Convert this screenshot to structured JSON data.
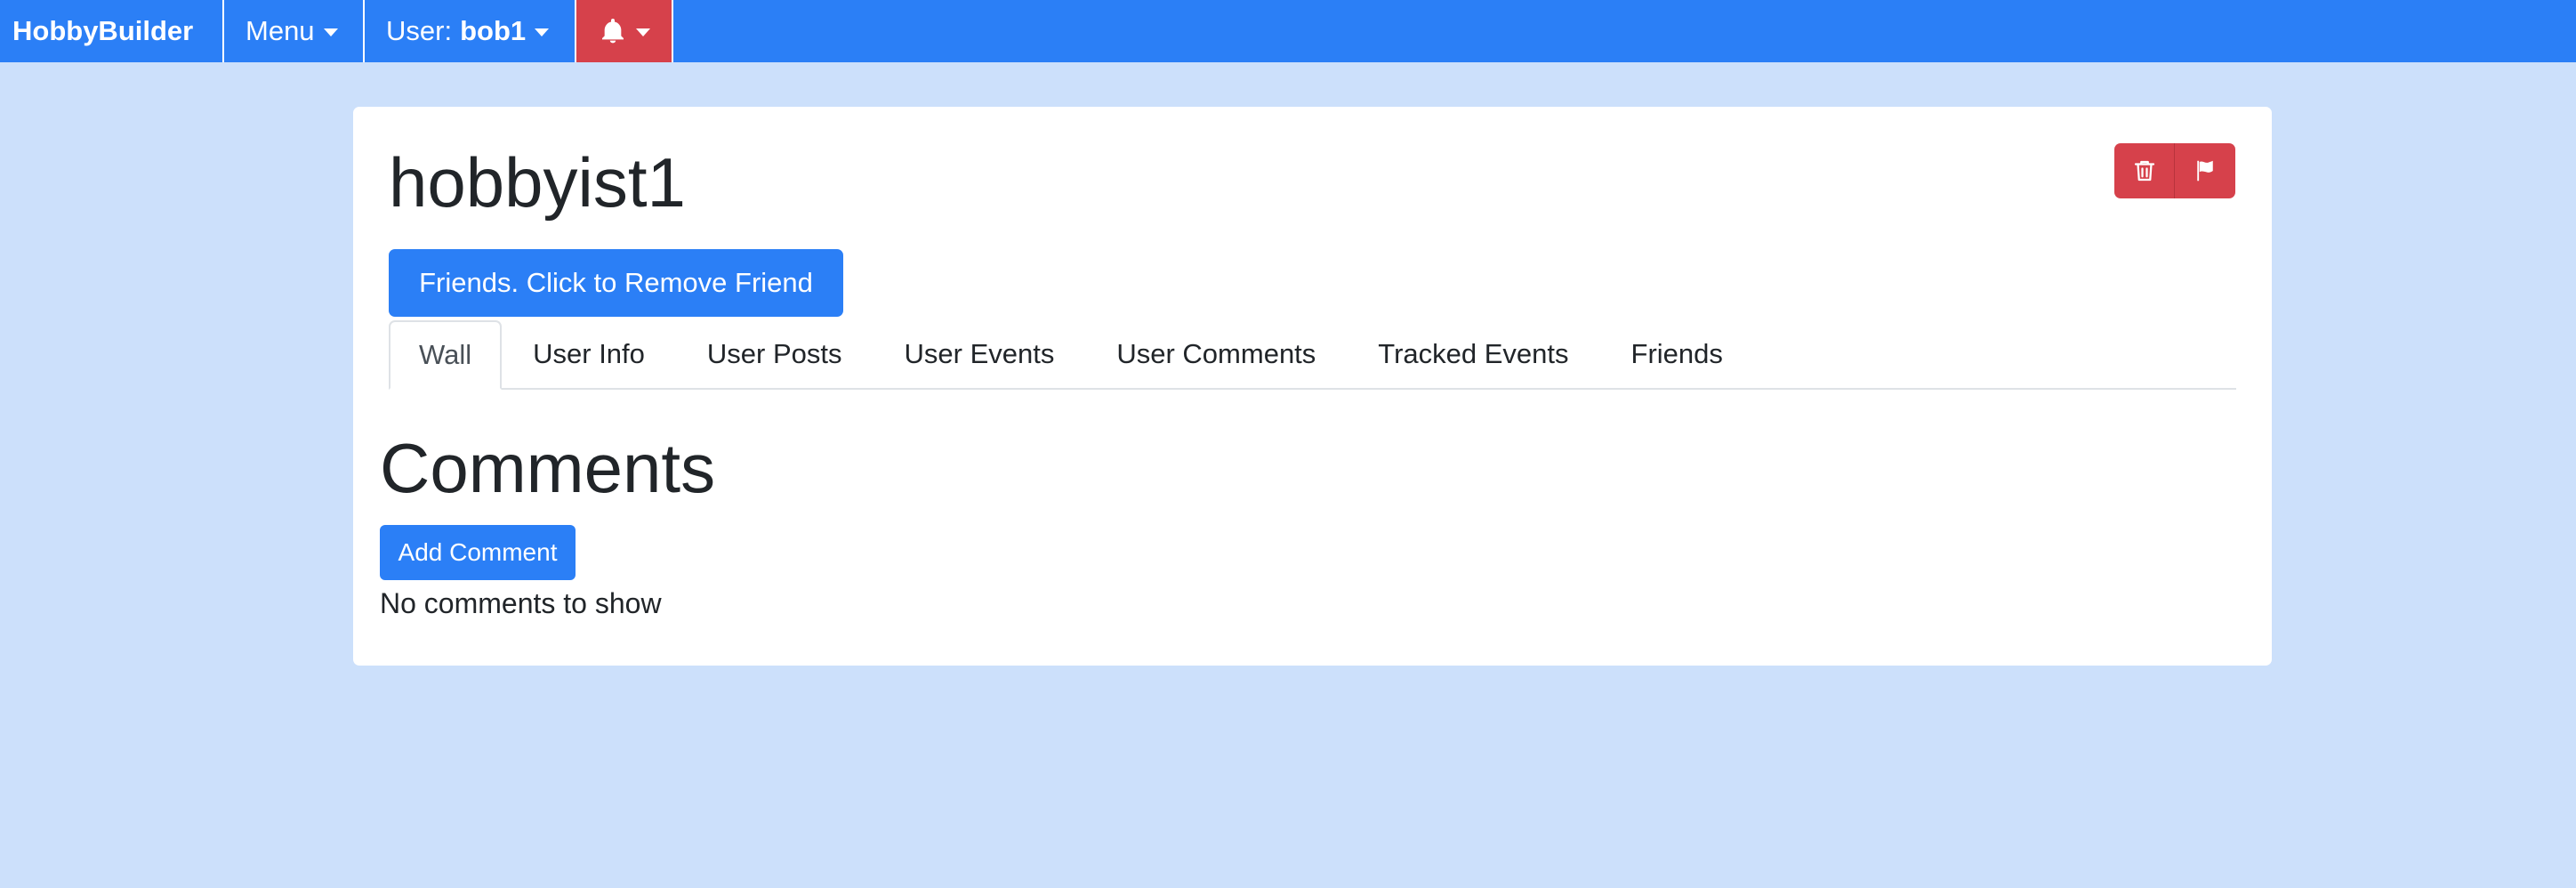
{
  "navbar": {
    "brand": "HobbyBuilder",
    "menu_label": "Menu",
    "user_prefix": "User:",
    "username": "bob1",
    "bell_icon": "bell-icon"
  },
  "profile": {
    "name": "hobbyist1",
    "friend_button_label": "Friends. Click to Remove Friend",
    "delete_icon": "trash-icon",
    "flag_icon": "flag-icon"
  },
  "tabs": [
    {
      "label": "Wall",
      "active": true
    },
    {
      "label": "User Info",
      "active": false
    },
    {
      "label": "User Posts",
      "active": false
    },
    {
      "label": "User Events",
      "active": false
    },
    {
      "label": "User Comments",
      "active": false
    },
    {
      "label": "Tracked Events",
      "active": false
    },
    {
      "label": "Friends",
      "active": false
    }
  ],
  "comments": {
    "title": "Comments",
    "add_button_label": "Add Comment",
    "empty_message": "No comments to show"
  },
  "colors": {
    "primary": "#2b7ff6",
    "danger": "#d6414b",
    "page_background": "#cce0fb",
    "card_background": "#ffffff"
  }
}
